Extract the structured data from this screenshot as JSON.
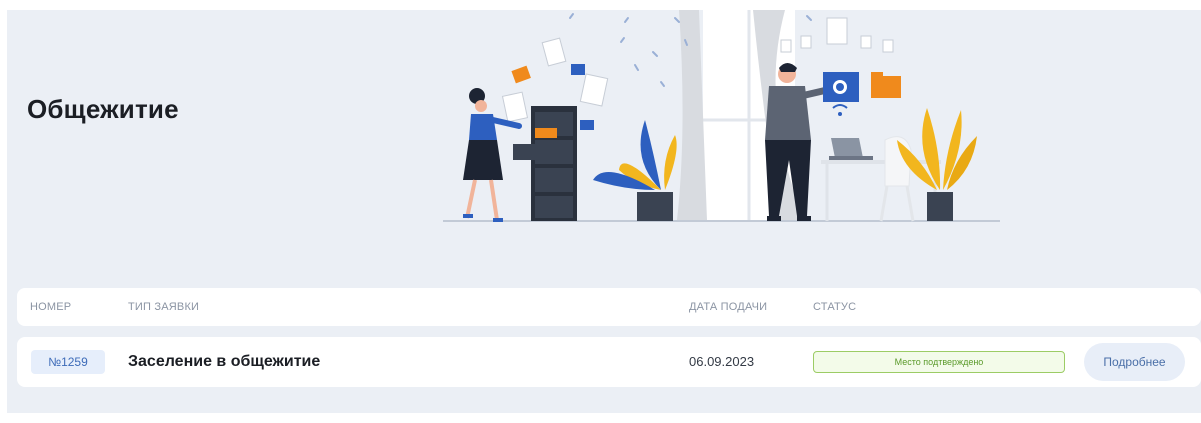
{
  "page": {
    "title": "Общежитие"
  },
  "table": {
    "headers": {
      "number": "НОМЕР",
      "type": "ТИП ЗАЯВКИ",
      "date": "ДАТА ПОДАЧИ",
      "status": "СТАТУС"
    },
    "rows": [
      {
        "number": "№1259",
        "type": "Заселение в общежитие",
        "date": "06.09.2023",
        "status": "Место подтверждено",
        "action": "Подробнее"
      }
    ]
  },
  "colors": {
    "panel_bg": "#ebeff5",
    "accent_blue": "#2d5fbf",
    "status_green": "#9ccc65",
    "plant_yellow": "#f2b61e",
    "folder_orange": "#f08a1c"
  },
  "icons": {
    "hero": "office-documents-illustration"
  }
}
